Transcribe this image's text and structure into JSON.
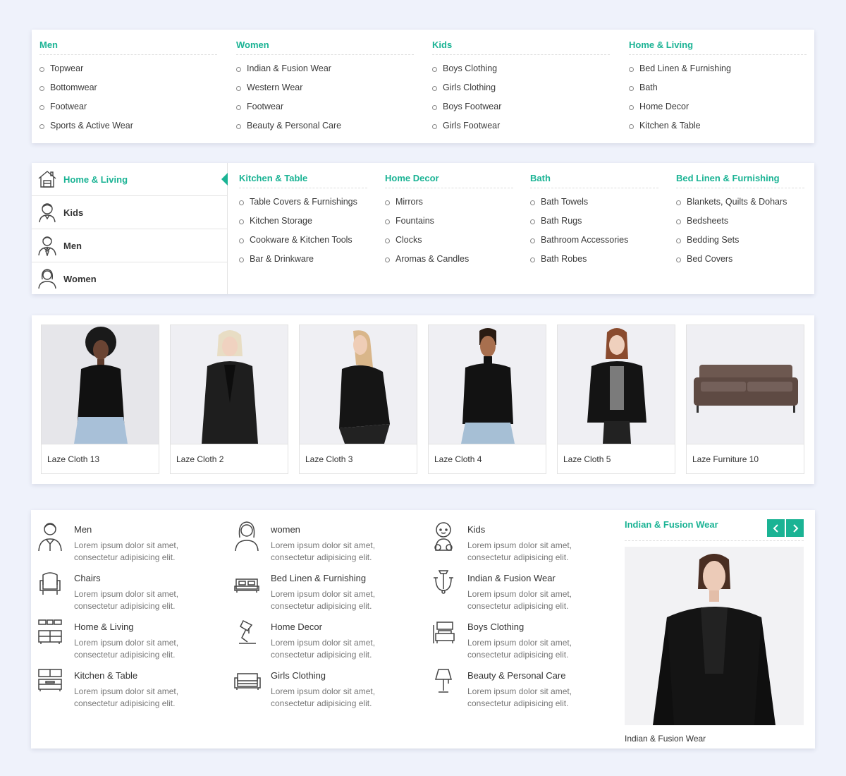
{
  "mega_menu_1": {
    "columns": [
      {
        "title": "Men",
        "items": [
          "Topwear",
          "Bottomwear",
          "Footwear",
          "Sports & Active Wear"
        ]
      },
      {
        "title": "Women",
        "items": [
          "Indian & Fusion Wear",
          "Western Wear",
          "Footwear",
          "Beauty & Personal Care"
        ]
      },
      {
        "title": "Kids",
        "items": [
          "Boys Clothing",
          "Girls Clothing",
          "Boys Footwear",
          "Girls Footwear"
        ]
      },
      {
        "title": "Home & Living",
        "items": [
          "Bed Linen & Furnishing",
          "Bath",
          "Home Decor",
          "Kitchen & Table"
        ]
      }
    ]
  },
  "mega_menu_2": {
    "sidebar": [
      {
        "label": "Home & Living",
        "icon": "house-icon",
        "active": true
      },
      {
        "label": "Kids",
        "icon": "kid-icon",
        "active": false
      },
      {
        "label": "Men",
        "icon": "man-icon",
        "active": false
      },
      {
        "label": "Women",
        "icon": "woman-icon",
        "active": false
      }
    ],
    "columns": [
      {
        "title": "Kitchen & Table",
        "items": [
          "Table Covers & Furnishings",
          "Kitchen Storage",
          "Cookware & Kitchen Tools",
          "Bar & Drinkware"
        ]
      },
      {
        "title": "Home Decor",
        "items": [
          "Mirrors",
          "Fountains",
          "Clocks",
          "Aromas & Candles"
        ]
      },
      {
        "title": "Bath",
        "items": [
          "Bath Towels",
          "Bath Rugs",
          "Bathroom Accessories",
          "Bath Robes"
        ]
      },
      {
        "title": "Bed Linen & Furnishing",
        "items": [
          "Blankets, Quilts & Dohars",
          "Bedsheets",
          "Bedding Sets",
          "Bed Covers"
        ]
      }
    ]
  },
  "products": [
    {
      "name": "Laze Cloth 13",
      "kind": "person-black-top-jeans"
    },
    {
      "name": "Laze Cloth 2",
      "kind": "person-leather-coat"
    },
    {
      "name": "Laze Cloth 3",
      "kind": "person-fringe-jacket"
    },
    {
      "name": "Laze Cloth 4",
      "kind": "person-black-top-jeans"
    },
    {
      "name": "Laze Cloth 5",
      "kind": "person-denim-jacket"
    },
    {
      "name": "Laze Furniture 10",
      "kind": "sofa"
    }
  ],
  "categories": [
    {
      "title": "Men",
      "desc": "Lorem ipsum dolor sit amet, consectetur adipisicing elit.",
      "icon": "man-icon"
    },
    {
      "title": "women",
      "desc": "Lorem ipsum dolor sit amet, consectetur adipisicing elit.",
      "icon": "woman-icon"
    },
    {
      "title": "Kids",
      "desc": "Lorem ipsum dolor sit amet, consectetur adipisicing elit.",
      "icon": "baby-icon"
    },
    {
      "title": "Chairs",
      "desc": "Lorem ipsum dolor sit amet, consectetur adipisicing elit.",
      "icon": "chair-icon"
    },
    {
      "title": "Bed Linen & Furnishing",
      "desc": "Lorem ipsum dolor sit amet, consectetur adipisicing elit.",
      "icon": "bed-icon"
    },
    {
      "title": "Indian & Fusion Wear",
      "desc": "Lorem ipsum dolor sit amet, consectetur adipisicing elit.",
      "icon": "chandelier-icon"
    },
    {
      "title": "Home & Living",
      "desc": "Lorem ipsum dolor sit amet, consectetur adipisicing elit.",
      "icon": "living-room-icon"
    },
    {
      "title": "Home Decor",
      "desc": "Lorem ipsum dolor sit amet, consectetur adipisicing elit.",
      "icon": "desk-lamp-icon"
    },
    {
      "title": "Boys Clothing",
      "desc": "Lorem ipsum dolor sit amet, consectetur adipisicing elit.",
      "icon": "armchair-icon"
    },
    {
      "title": "Kitchen & Table",
      "desc": "Lorem ipsum dolor sit amet, consectetur adipisicing elit.",
      "icon": "kitchen-icon"
    },
    {
      "title": "Girls Clothing",
      "desc": "Lorem ipsum dolor sit amet, consectetur adipisicing elit.",
      "icon": "sofa-icon"
    },
    {
      "title": "Beauty & Personal Care",
      "desc": "Lorem ipsum dolor sit amet, consectetur adipisicing elit.",
      "icon": "floor-lamp-icon"
    }
  ],
  "featured": {
    "title": "Indian & Fusion Wear",
    "caption": "Indian & Fusion Wear",
    "prev_icon": "chevron-left-icon",
    "next_icon": "chevron-right-icon"
  },
  "colors": {
    "accent": "#1ab394",
    "background": "#eff2fb"
  }
}
